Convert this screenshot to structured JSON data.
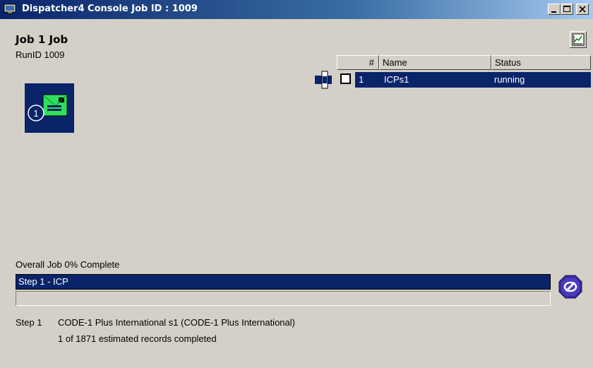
{
  "window": {
    "title": "Dispatcher4 Console Job ID : 1009",
    "title_icon": "monitor-icon",
    "controls": [
      "minimize-icon",
      "maximize-icon",
      "close-icon"
    ]
  },
  "job": {
    "title": "Job 1 Job",
    "run_id": "RunID 1009",
    "step_icon_number": "1",
    "step_icon": "envelope-icon"
  },
  "toolbar": {
    "graph_icon": "chart-icon"
  },
  "steps_table": {
    "columns": [
      "#",
      "Name",
      "Status"
    ],
    "rows": [
      {
        "num": "1",
        "name": "ICPs1",
        "status": "running",
        "selected": true,
        "checked": false
      }
    ]
  },
  "progress": {
    "overall_label": "Overall Job 0% Complete",
    "step_label": "Step 1 - ICP",
    "fraction": 0,
    "stop_icon": "stop-icon"
  },
  "details": {
    "step": "Step 1",
    "description": "CODE-1 Plus International s1 (CODE-1 Plus International)",
    "records": "1 of 1871 estimated records completed"
  },
  "colors": {
    "titlebar_start": "#0a246a",
    "titlebar_end": "#a6caf0",
    "selection": "#0a246a",
    "window_bg": "#d4d0c8"
  }
}
